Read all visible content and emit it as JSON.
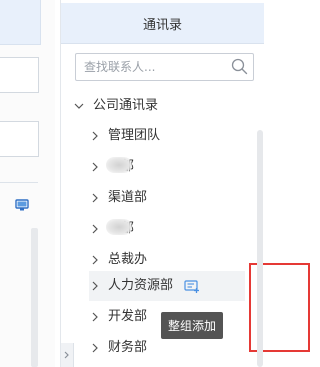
{
  "panel": {
    "title": "通讯录",
    "search": {
      "placeholder": "查找联系人..."
    }
  },
  "tree": {
    "root": {
      "label": "公司通讯录",
      "expanded": true
    },
    "items": [
      {
        "label": "管理团队"
      },
      {
        "label": "部"
      },
      {
        "label": "渠道部"
      },
      {
        "label": "部"
      },
      {
        "label": "总裁办"
      },
      {
        "label": "人力资源部",
        "selected": true
      },
      {
        "label": "开发部"
      },
      {
        "label": "财务部"
      }
    ]
  },
  "tooltip": {
    "text": "整组添加"
  },
  "colors": {
    "header_bg": "#e8f0fb",
    "highlight": "#e53935",
    "tooltip_bg": "#545454",
    "icon_blue": "#4a90e2"
  },
  "icons": [
    "search-icon",
    "chevron-down-icon",
    "chevron-right-icon",
    "group-add-icon",
    "monitor-icon",
    "collapse-arrow-icon"
  ]
}
